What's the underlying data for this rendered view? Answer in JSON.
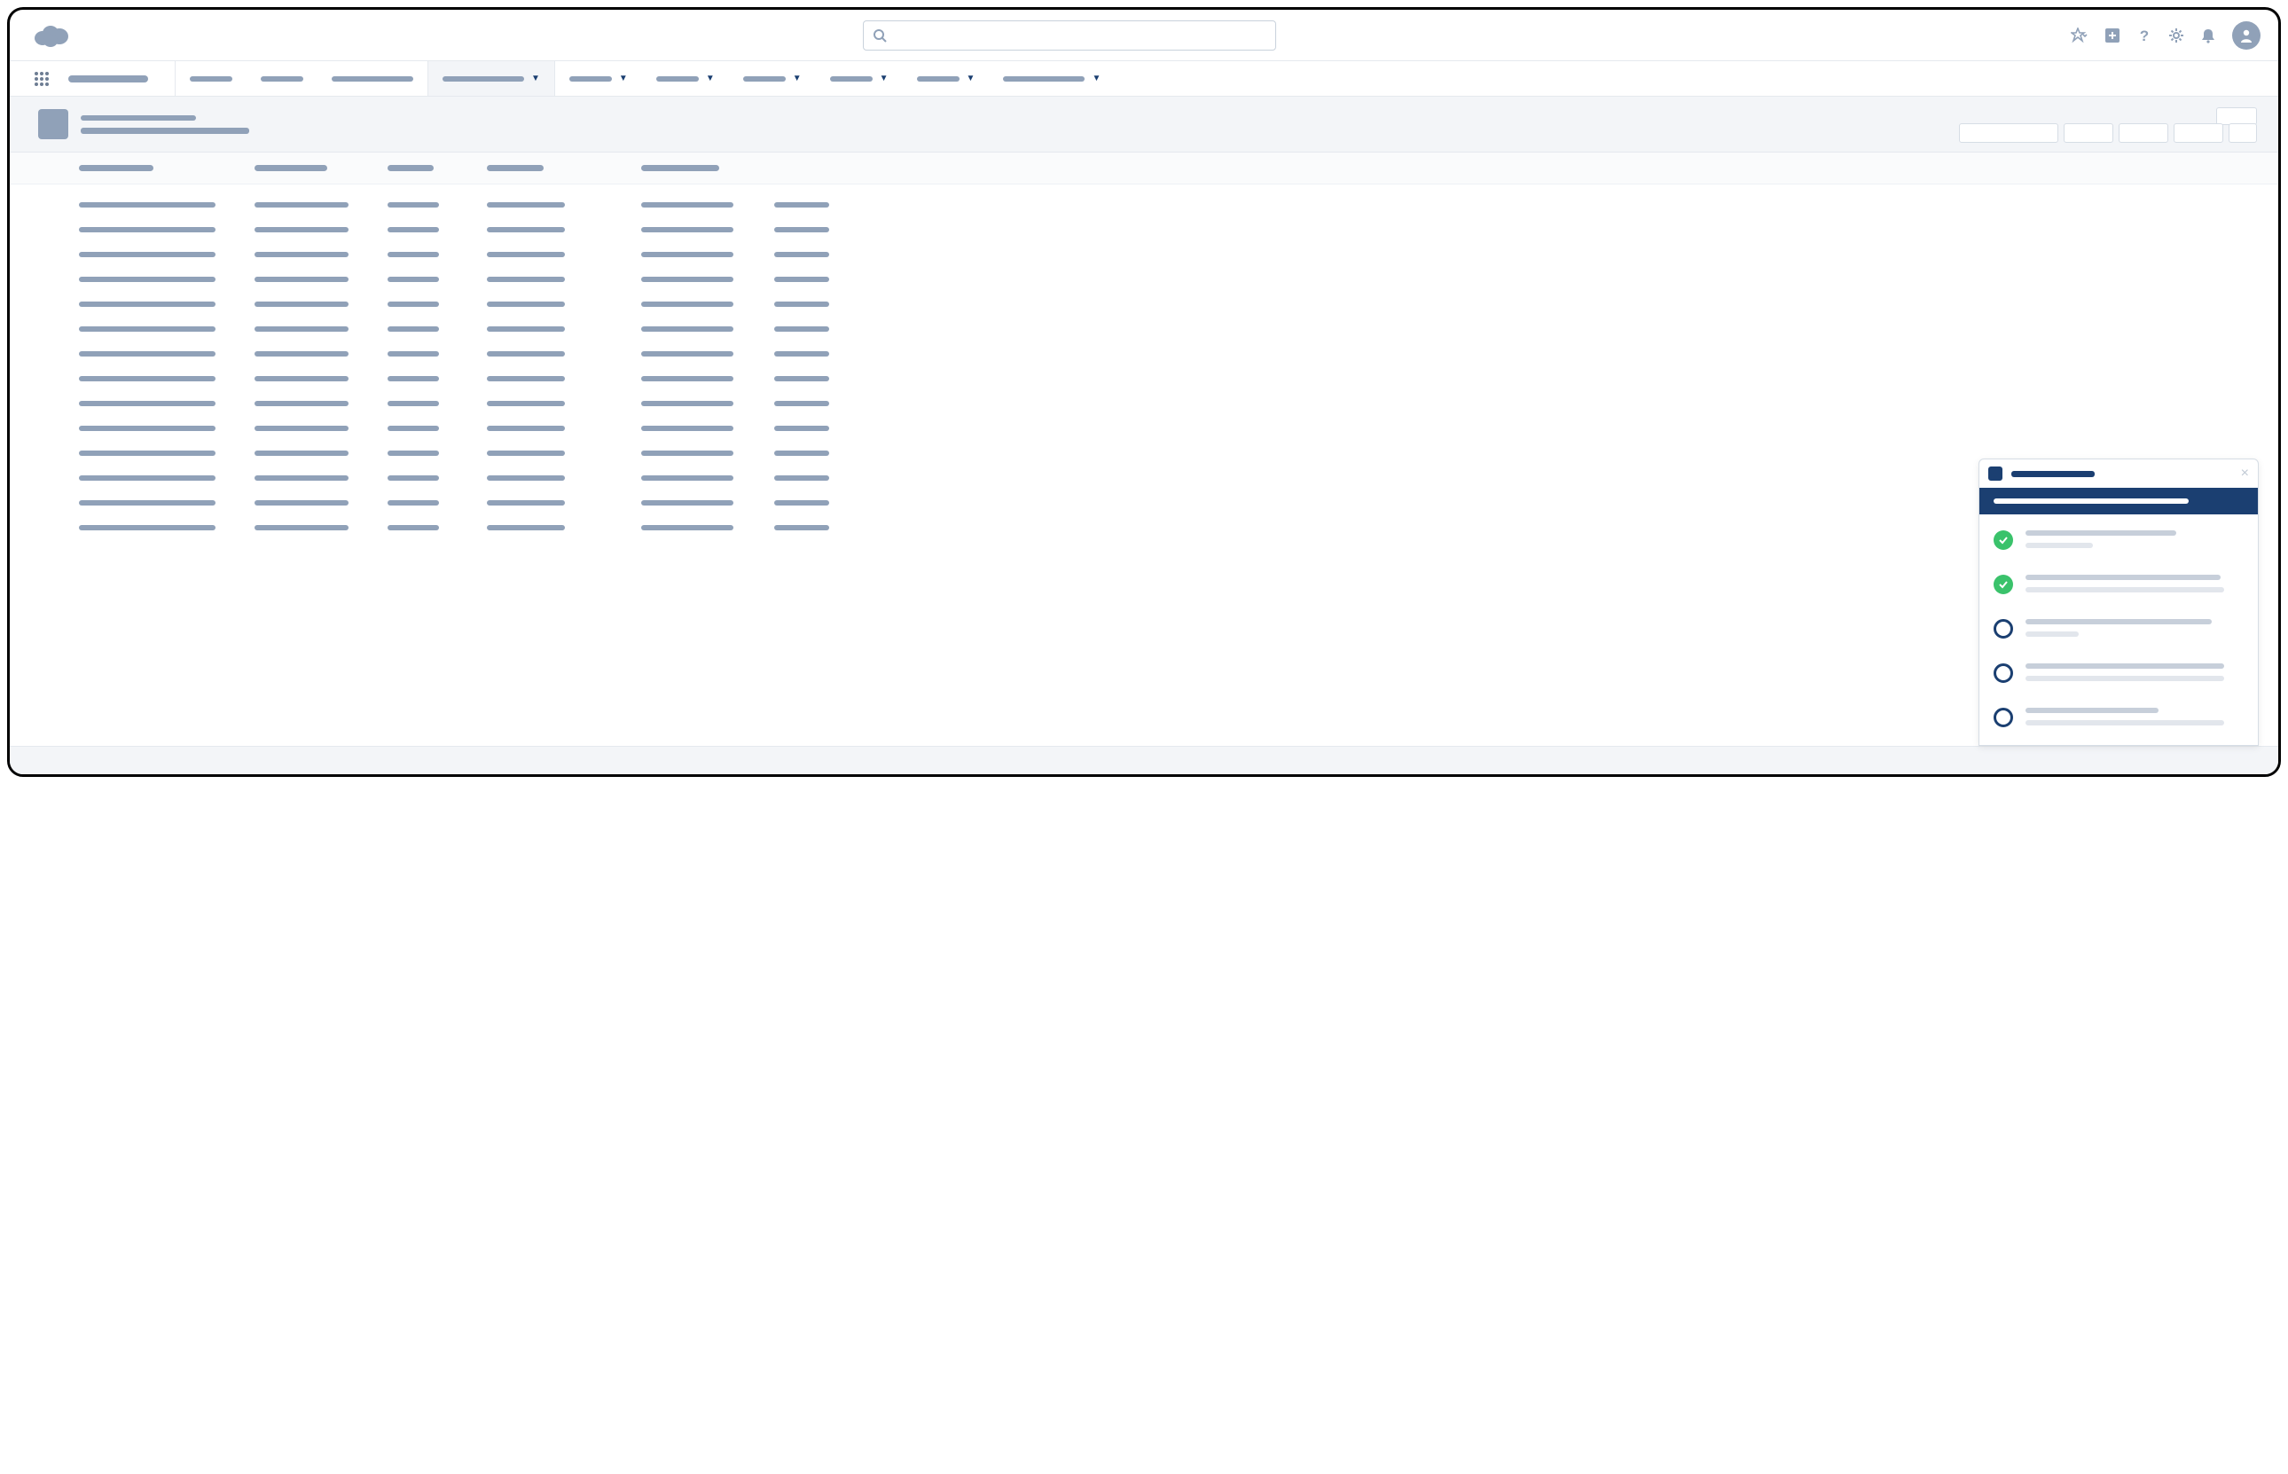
{
  "header": {
    "search_placeholder": "",
    "icons": [
      "favorites",
      "add",
      "help",
      "setup",
      "notifications",
      "profile"
    ]
  },
  "nav": {
    "app_label": "",
    "tabs": [
      {
        "label": "",
        "has_chevron": false,
        "active": false
      },
      {
        "label": "",
        "has_chevron": false,
        "active": false
      },
      {
        "label": "",
        "has_chevron": false,
        "active": false
      },
      {
        "label": "",
        "has_chevron": true,
        "active": true
      },
      {
        "label": "",
        "has_chevron": true,
        "active": false
      },
      {
        "label": "",
        "has_chevron": true,
        "active": false
      },
      {
        "label": "",
        "has_chevron": true,
        "active": false
      },
      {
        "label": "",
        "has_chevron": true,
        "active": false
      },
      {
        "label": "",
        "has_chevron": true,
        "active": false
      },
      {
        "label": "",
        "has_chevron": true,
        "active": false
      }
    ]
  },
  "page": {
    "object_label": "",
    "record_title": "",
    "actions": [
      "",
      "",
      "",
      "",
      ""
    ]
  },
  "columns": [
    "",
    "",
    "",
    "",
    ""
  ],
  "rows": [
    [
      "",
      "",
      "",
      "",
      "",
      ""
    ],
    [
      "",
      "",
      "",
      "",
      "",
      ""
    ],
    [
      "",
      "",
      "",
      "",
      "",
      ""
    ],
    [
      "",
      "",
      "",
      "",
      "",
      ""
    ],
    [
      "",
      "",
      "",
      "",
      "",
      ""
    ],
    [
      "",
      "",
      "",
      "",
      "",
      ""
    ],
    [
      "",
      "",
      "",
      "",
      "",
      ""
    ],
    [
      "",
      "",
      "",
      "",
      "",
      ""
    ],
    [
      "",
      "",
      "",
      "",
      "",
      ""
    ],
    [
      "",
      "",
      "",
      "",
      "",
      ""
    ],
    [
      "",
      "",
      "",
      "",
      "",
      ""
    ],
    [
      "",
      "",
      "",
      "",
      "",
      ""
    ],
    [
      "",
      "",
      "",
      "",
      "",
      ""
    ],
    [
      "",
      "",
      "",
      "",
      "",
      ""
    ]
  ],
  "panel": {
    "title": "",
    "banner": "",
    "steps": [
      {
        "status": "done",
        "title": "",
        "subtitle": ""
      },
      {
        "status": "done",
        "title": "",
        "subtitle": ""
      },
      {
        "status": "todo",
        "title": "",
        "subtitle": ""
      },
      {
        "status": "todo",
        "title": "",
        "subtitle": ""
      },
      {
        "status": "todo",
        "title": "",
        "subtitle": ""
      }
    ]
  },
  "colors": {
    "placeholder": "#90a1b8",
    "brand_dark": "#1b3f71",
    "success": "#3ac26b",
    "panel_light": "#e2e6ec"
  }
}
